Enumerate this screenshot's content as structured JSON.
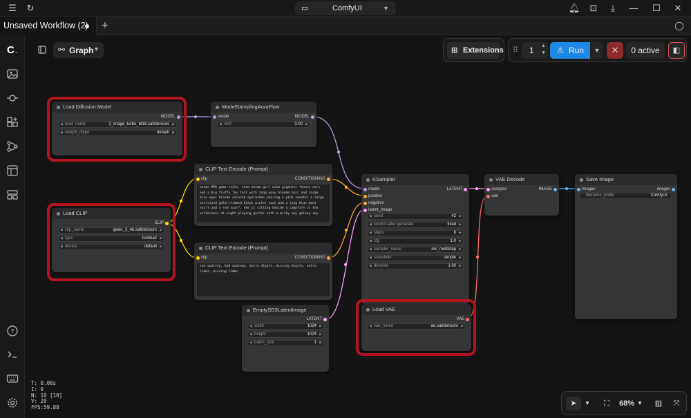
{
  "app": {
    "title": "ComfyUI"
  },
  "tabs": [
    {
      "label": "Unsaved Workflow (2)",
      "modified": true
    }
  ],
  "toolbar": {
    "graph_label": "Graph",
    "extensions_label": "Extensions",
    "batch_count": "1",
    "run_label": "Run",
    "queue_label": "0 active"
  },
  "colors": {
    "model": "#b39ddb",
    "clip": "#ffd500",
    "conditioning": "#ffa931",
    "latent": "#ff9cf9",
    "image": "#64b5f6",
    "vae": "#ff6e6e",
    "run": "#1e88e5",
    "highlight": "#b3131f"
  },
  "nodes": {
    "load_diffusion": {
      "title": "Load Diffusion Model",
      "outputs": [
        "MODEL"
      ],
      "widgets": [
        {
          "name": "unet_name",
          "value": "z_image_turbo_bf16.safetensors"
        },
        {
          "name": "weight_dtype",
          "value": "default"
        }
      ]
    },
    "model_sampling": {
      "title": "ModelSamplingAuraFlow",
      "inputs": [
        "model"
      ],
      "outputs": [
        "MODEL"
      ],
      "widgets": [
        {
          "name": "shift",
          "value": "3.00"
        }
      ]
    },
    "clip_pos": {
      "title": "CLIP Text Encode (Prompt)",
      "inputs": [
        "clip"
      ],
      "outputs": [
        "CONDITIONING"
      ],
      "text": "anime RPG game style, cute anime girl with gigantic fennec ears and a big fluffy fox tail with long wavy blonde hair and large blue eyes blonde colored eyelashes wearing a pink sweater a large oversized gold trimmed black winter coat and a long blue maxi skirt and a red scarf, she is sitting beside a campfire in the wilderness at night playing guitar with a milky way galaxy sky"
    },
    "clip_neg": {
      "title": "CLIP Text Encode (Prompt)",
      "inputs": [
        "clip"
      ],
      "outputs": [
        "CONDITIONING"
      ],
      "text": "low quality, bad anatomy, extra digits, missing digits, extra limbs, missing limbs"
    },
    "load_clip": {
      "title": "Load CLIP",
      "outputs": [
        "CLIP"
      ],
      "widgets": [
        {
          "name": "clip_name",
          "value": "qwen_3_4b.safetensors"
        },
        {
          "name": "type",
          "value": "lumina2"
        },
        {
          "name": "device",
          "value": "default"
        }
      ]
    },
    "ksampler": {
      "title": "KSampler",
      "inputs": [
        "model",
        "positive",
        "negative",
        "latent_image"
      ],
      "outputs": [
        "LATENT"
      ],
      "widgets": [
        {
          "name": "seed",
          "value": "42"
        },
        {
          "name": "control after generate",
          "value": "fixed"
        },
        {
          "name": "steps",
          "value": "8"
        },
        {
          "name": "cfg",
          "value": "1.0"
        },
        {
          "name": "sampler_name",
          "value": "res_multistep"
        },
        {
          "name": "scheduler",
          "value": "simple"
        },
        {
          "name": "denoise",
          "value": "1.00"
        }
      ]
    },
    "vae_decode": {
      "title": "VAE Decode",
      "inputs": [
        "samples",
        "vae"
      ],
      "outputs": [
        "IMAGE"
      ]
    },
    "save_image": {
      "title": "Save Image",
      "inputs": [
        "images"
      ],
      "outputs": [
        "images"
      ],
      "widgets": [
        {
          "name": "filename_prefix",
          "value": "ComfyUI"
        }
      ]
    },
    "empty_latent": {
      "title": "EmptySD3LatentImage",
      "outputs": [
        "LATENT"
      ],
      "widgets": [
        {
          "name": "width",
          "value": "1024"
        },
        {
          "name": "height",
          "value": "1024"
        },
        {
          "name": "batch_size",
          "value": "1"
        }
      ]
    },
    "load_vae": {
      "title": "Load VAE",
      "outputs": [
        "VAE"
      ],
      "widgets": [
        {
          "name": "vae_name",
          "value": "ae.safetensors"
        }
      ]
    }
  },
  "stats": {
    "t": "T: 0.00s",
    "i": "I: 0",
    "n": "N: 10 [10]",
    "v": "V: 20",
    "fps": "FPS:59.88"
  },
  "bottom": {
    "zoom": "68%"
  }
}
